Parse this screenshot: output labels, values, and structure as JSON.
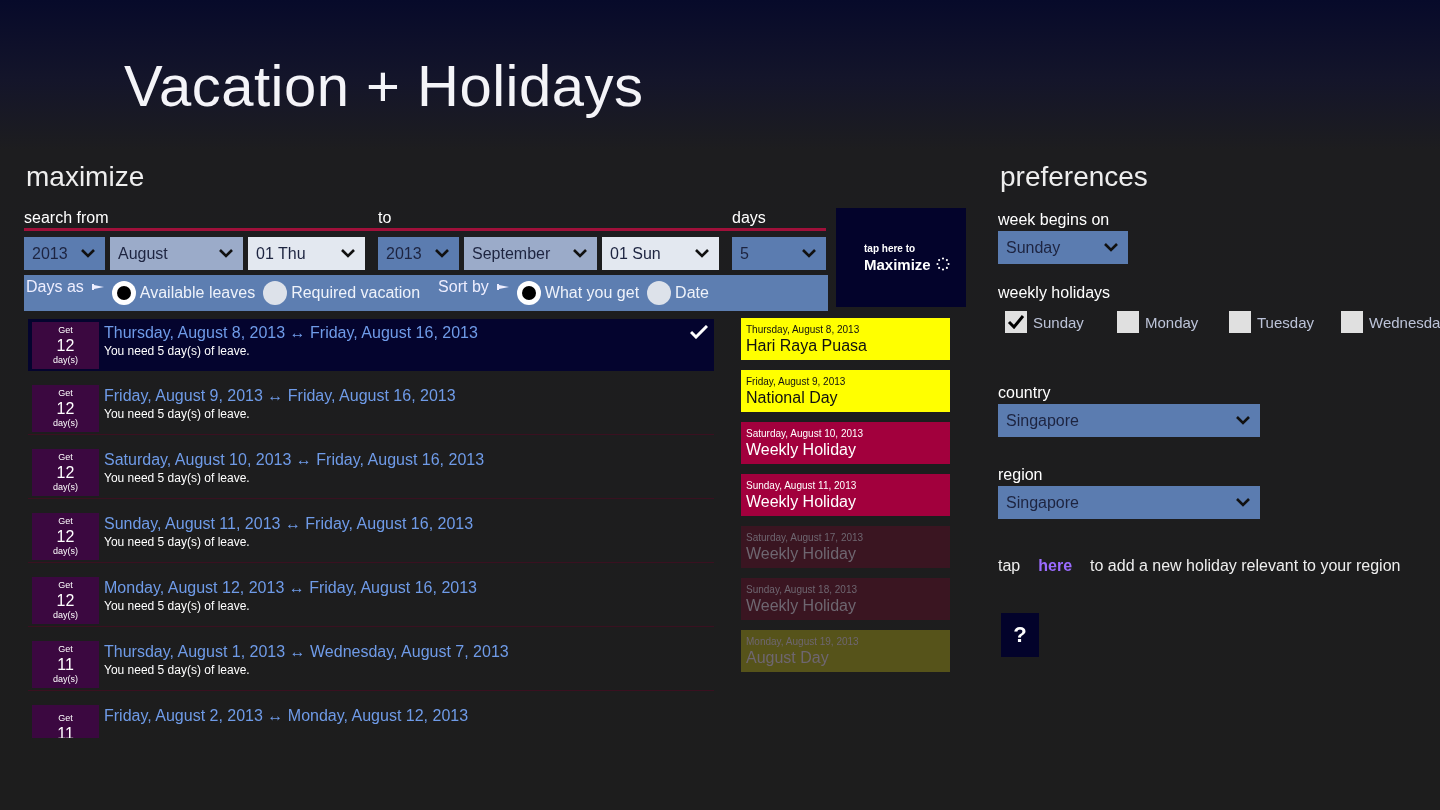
{
  "title": "Vacation + Holidays",
  "maximize": {
    "heading": "maximize",
    "groups": [
      {
        "label": "search from",
        "selects": [
          {
            "value": "2013",
            "kind": "dark"
          },
          {
            "value": "August",
            "kind": "light"
          },
          {
            "value": "01 Thu",
            "kind": "white"
          }
        ]
      },
      {
        "label": "to",
        "selects": [
          {
            "value": "2013",
            "kind": "dark"
          },
          {
            "value": "September",
            "kind": "light"
          },
          {
            "value": "01 Sun",
            "kind": "white"
          }
        ]
      },
      {
        "label": "days",
        "selects": [
          {
            "value": "5",
            "kind": "dark"
          }
        ]
      }
    ],
    "options": [
      {
        "label": "Days as",
        "choices": [
          {
            "label": "Available leaves",
            "selected": true
          },
          {
            "label": "Required vacation",
            "selected": false
          }
        ]
      },
      {
        "label": "Sort by",
        "choices": [
          {
            "label": "What you get",
            "selected": true
          },
          {
            "label": "Date",
            "selected": false
          }
        ]
      }
    ],
    "button": {
      "small": "tap here to",
      "big": "Maximize"
    }
  },
  "results": [
    {
      "get": "Get",
      "count": "12",
      "unit": "day(s)",
      "range": "Thursday, August 8, 2013 ↔ Friday, August 16, 2013",
      "need": "You need 5 day(s) of leave.",
      "selected": true
    },
    {
      "get": "Get",
      "count": "12",
      "unit": "day(s)",
      "range": "Friday, August 9, 2013 ↔ Friday, August 16, 2013",
      "need": "You need 5 day(s) of leave.",
      "selected": false
    },
    {
      "get": "Get",
      "count": "12",
      "unit": "day(s)",
      "range": "Saturday, August 10, 2013 ↔ Friday, August 16, 2013",
      "need": "You need 5 day(s) of leave.",
      "selected": false
    },
    {
      "get": "Get",
      "count": "12",
      "unit": "day(s)",
      "range": "Sunday, August 11, 2013 ↔ Friday, August 16, 2013",
      "need": "You need 5 day(s) of leave.",
      "selected": false
    },
    {
      "get": "Get",
      "count": "12",
      "unit": "day(s)",
      "range": "Monday, August 12, 2013 ↔ Friday, August 16, 2013",
      "need": "You need 5 day(s) of leave.",
      "selected": false
    },
    {
      "get": "Get",
      "count": "11",
      "unit": "day(s)",
      "range": "Thursday, August 1, 2013 ↔ Wednesday, August 7, 2013",
      "need": "You need 5 day(s) of leave.",
      "selected": false
    },
    {
      "get": "Get",
      "count": "11",
      "range": "Friday, August 2, 2013 ↔ Monday, August 12, 2013",
      "selected": false
    }
  ],
  "holidays": [
    {
      "date": "Thursday, August 8, 2013",
      "name": "Hari Raya Puasa",
      "color": "#ffff00",
      "faded": false
    },
    {
      "date": "Friday, August 9, 2013",
      "name": "National Day",
      "color": "#ffff00",
      "faded": false
    },
    {
      "date": "Saturday, August 10, 2013",
      "name": "Weekly Holiday",
      "color": "#a2003d",
      "faded": false
    },
    {
      "date": "Sunday, August 11, 2013",
      "name": "Weekly Holiday",
      "color": "#a2003d",
      "faded": false
    },
    {
      "date": "Saturday, August 17, 2013",
      "name": "Weekly Holiday",
      "color": "#3a1521",
      "faded": true
    },
    {
      "date": "Sunday, August 18, 2013",
      "name": "Weekly Holiday",
      "color": "#3a1521",
      "faded": true
    },
    {
      "date": "Monday, August 19, 2013",
      "name": "August Day",
      "color": "#56531a",
      "faded": true
    }
  ],
  "preferences": {
    "heading": "preferences",
    "week_begins": {
      "label": "week begins on",
      "value": "Sunday"
    },
    "weekly_holidays": {
      "label": "weekly holidays",
      "days": [
        {
          "label": "Sunday",
          "checked": true
        },
        {
          "label": "Monday",
          "checked": false
        },
        {
          "label": "Tuesday",
          "checked": false
        },
        {
          "label": "Wednesda",
          "checked": false
        }
      ]
    },
    "country": {
      "label": "country",
      "value": "Singapore"
    },
    "region": {
      "label": "region",
      "value": "Singapore"
    },
    "tip": {
      "before": "tap",
      "link": "here",
      "after": "to add a new holiday relevant to your region"
    },
    "help": "?"
  }
}
